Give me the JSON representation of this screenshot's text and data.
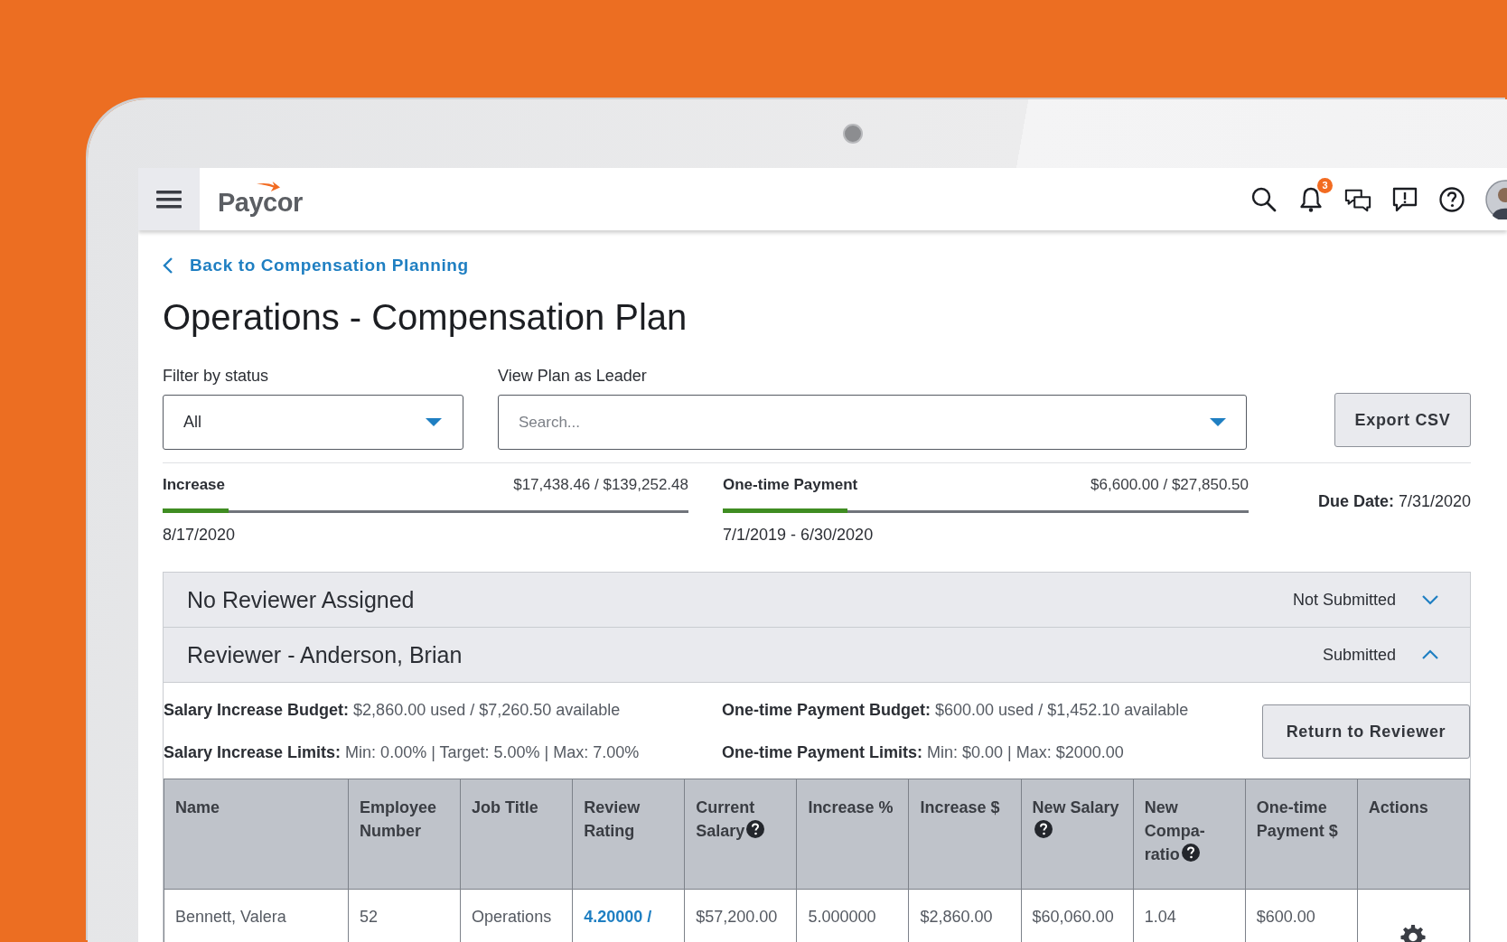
{
  "header": {
    "logo": "Paycor",
    "notification_count": "3"
  },
  "back_link": "Back to Compensation Planning",
  "title": "Operations - Compensation Plan",
  "filters": [
    {
      "label": "Filter by status",
      "value": "All"
    },
    {
      "label": "View Plan as Leader",
      "placeholder": "Search..."
    }
  ],
  "export_button": "Export CSV",
  "progress": [
    {
      "label": "Increase",
      "amount": "$17,438.46 / $139,252.48",
      "level": 0.125,
      "date": "8/17/2020"
    },
    {
      "label": "One-time Payment",
      "amount": "$6,600.00 / $27,850.50",
      "level": 0.237,
      "date": "7/1/2019 - 6/30/2020"
    }
  ],
  "due_date": {
    "label": "Due Date:",
    "value": "7/31/2020"
  },
  "sections": [
    {
      "title": "No Reviewer Assigned",
      "status": "Not Submitted",
      "expanded": false
    },
    {
      "title": "Reviewer - Anderson, Brian",
      "status": "Submitted",
      "expanded": true,
      "budget": [
        {
          "label": "Salary Increase Budget:",
          "value": "$2,860.00 used / $7,260.50 available"
        },
        {
          "label": "One-time Payment Budget:",
          "value": "$600.00 used / $1,452.10 available"
        },
        {
          "label": "Salary Increase Limits:",
          "value": "Min: 0.00% | Target: 5.00% | Max: 7.00%"
        },
        {
          "label": "One-time Payment Limits:",
          "value": "Min: $0.00 | Max: $2000.00"
        }
      ],
      "return_button": "Return to Reviewer",
      "table": {
        "columns": [
          {
            "label": "Name",
            "help": false
          },
          {
            "label": "Employee Number",
            "help": false
          },
          {
            "label": "Job Title",
            "help": false
          },
          {
            "label": "Review Rating",
            "help": false
          },
          {
            "label": "Current Salary",
            "help": true
          },
          {
            "label": "Increase %",
            "help": false
          },
          {
            "label": "Increase $",
            "help": false
          },
          {
            "label": "New Salary",
            "help": true
          },
          {
            "label": "New Compa-ratio",
            "help": true
          },
          {
            "label": "One-time Payment $",
            "help": false
          },
          {
            "label": "Actions",
            "help": false
          }
        ],
        "rows": [
          {
            "cells": [
              {
                "kind": "text",
                "text": "Bennett, Valera"
              },
              {
                "kind": "text",
                "text": "52"
              },
              {
                "kind": "text",
                "text": "Operations"
              },
              {
                "kind": "link",
                "text": "4.20000 /"
              },
              {
                "kind": "text",
                "text": "$57,200.00"
              },
              {
                "kind": "text",
                "text": "5.000000"
              },
              {
                "kind": "text",
                "text": "$2,860.00"
              },
              {
                "kind": "text",
                "text": "$60,060.00"
              },
              {
                "kind": "text",
                "text": "1.04"
              },
              {
                "kind": "text",
                "text": "$600.00"
              },
              {
                "kind": "actions"
              }
            ]
          }
        ]
      }
    }
  ]
}
